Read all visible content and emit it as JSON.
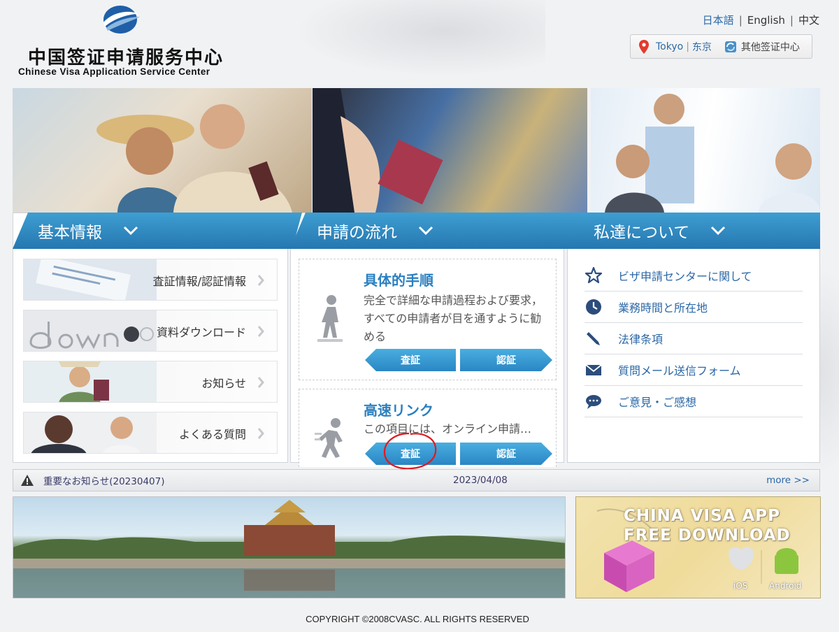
{
  "header": {
    "logo_cn": "中国签证申请服务中心",
    "logo_en": "Chinese Visa Application Service Center",
    "languages": [
      "日本語",
      "English",
      "中文"
    ],
    "location_city": "Tokyo",
    "location_city_cn": "东京",
    "location_sep": "|",
    "other_centers": "其他签证中心"
  },
  "sections": [
    {
      "title": "基本情報"
    },
    {
      "title": "申請の流れ"
    },
    {
      "title": "私達について"
    }
  ],
  "basic_menu": [
    {
      "label": "査証情報/認証情報",
      "icon": "information-thumb"
    },
    {
      "label": "資料ダウンロード",
      "icon": "download-thumb"
    },
    {
      "label": "お知らせ",
      "icon": "news-thumb"
    },
    {
      "label": "よくある質問",
      "icon": "faq-thumb"
    }
  ],
  "process": {
    "steps_title": "具体的手順",
    "steps_text": "完全で詳細な申請過程および要求，すべての申請者が目を通すように勧める",
    "quick_title": "高速リンク",
    "quick_text": "この項目には、オンライン申請…",
    "btn_visa": "査証",
    "btn_cert": "認証"
  },
  "about_menu": [
    {
      "label": "ビザ申請センターに関して",
      "icon": "star-icon"
    },
    {
      "label": "業務時間と所在地",
      "icon": "clock-icon"
    },
    {
      "label": "法律条項",
      "icon": "pen-icon"
    },
    {
      "label": "質問メール送信フォーム",
      "icon": "mail-icon"
    },
    {
      "label": "ご意見・ご感想",
      "icon": "chat-icon"
    }
  ],
  "notice": {
    "text": "重要なお知らせ(20230407)",
    "date": "2023/04/08",
    "more": "more >>"
  },
  "app_banner": {
    "line1": "CHINA VISA  APP",
    "line2": "FREE DOWNLOAD",
    "ios": "iOS",
    "android": "Android"
  },
  "footer": {
    "copyright": "COPYRIGHT ©2008CVASC. ALL RIGHTS RESERVED"
  },
  "colors": {
    "accent": "#2a7fc0",
    "section_bar": "#2f8ac6",
    "link": "#2a67a6",
    "annotation": "#e0191f"
  }
}
